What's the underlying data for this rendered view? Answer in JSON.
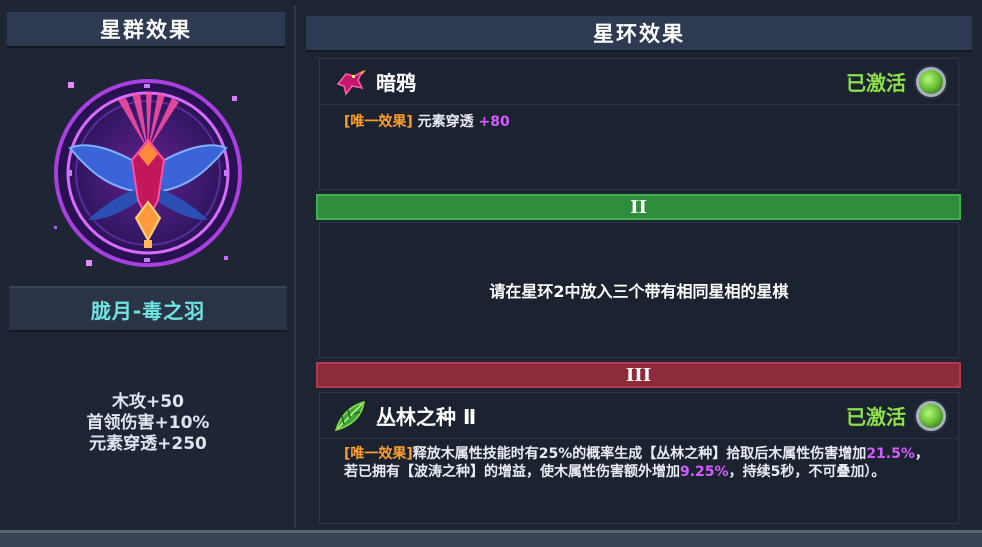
{
  "left": {
    "header": "星群效果",
    "emblem_icon": "raven-constellation-emblem",
    "constellation_name": "胧月-毒之羽",
    "stats": [
      "木攻+50",
      "首领伤害+10%",
      "元素穿透+250"
    ]
  },
  "right": {
    "header": "星环效果",
    "ring1": {
      "icon": "raven-icon",
      "name": "暗鸦",
      "status": "已激活",
      "tag": "[唯一效果]",
      "desc_text": "元素穿透",
      "desc_value": "+80"
    },
    "tier2": {
      "label": "II",
      "message": "请在星环2中放入三个带有相同星相的星棋"
    },
    "tier3": {
      "label": "III"
    },
    "ring3": {
      "icon": "leaf-seed-icon",
      "name": "丛林之种 Ⅱ",
      "status": "已激活",
      "tag": "[唯一效果]",
      "desc_part1": "释放木属性技能时有25%的概率生成【丛林之种】拾取后木属性伤害增加",
      "desc_val1": "21.5%",
      "desc_part2": "，若已拥有【波涛之种】的增益，使木属性伤害额外增加",
      "desc_val2": "9.25%",
      "desc_part3": "，持续5秒，不可叠加）。"
    }
  },
  "colors": {
    "active_green": "#8ee04a",
    "tag_orange": "#ff9e2b",
    "highlight_purple": "#d35dff",
    "name_cyan": "#6fe5e2",
    "tier2_green": "#2f8d3e",
    "tier3_red": "#8e2b3b"
  }
}
